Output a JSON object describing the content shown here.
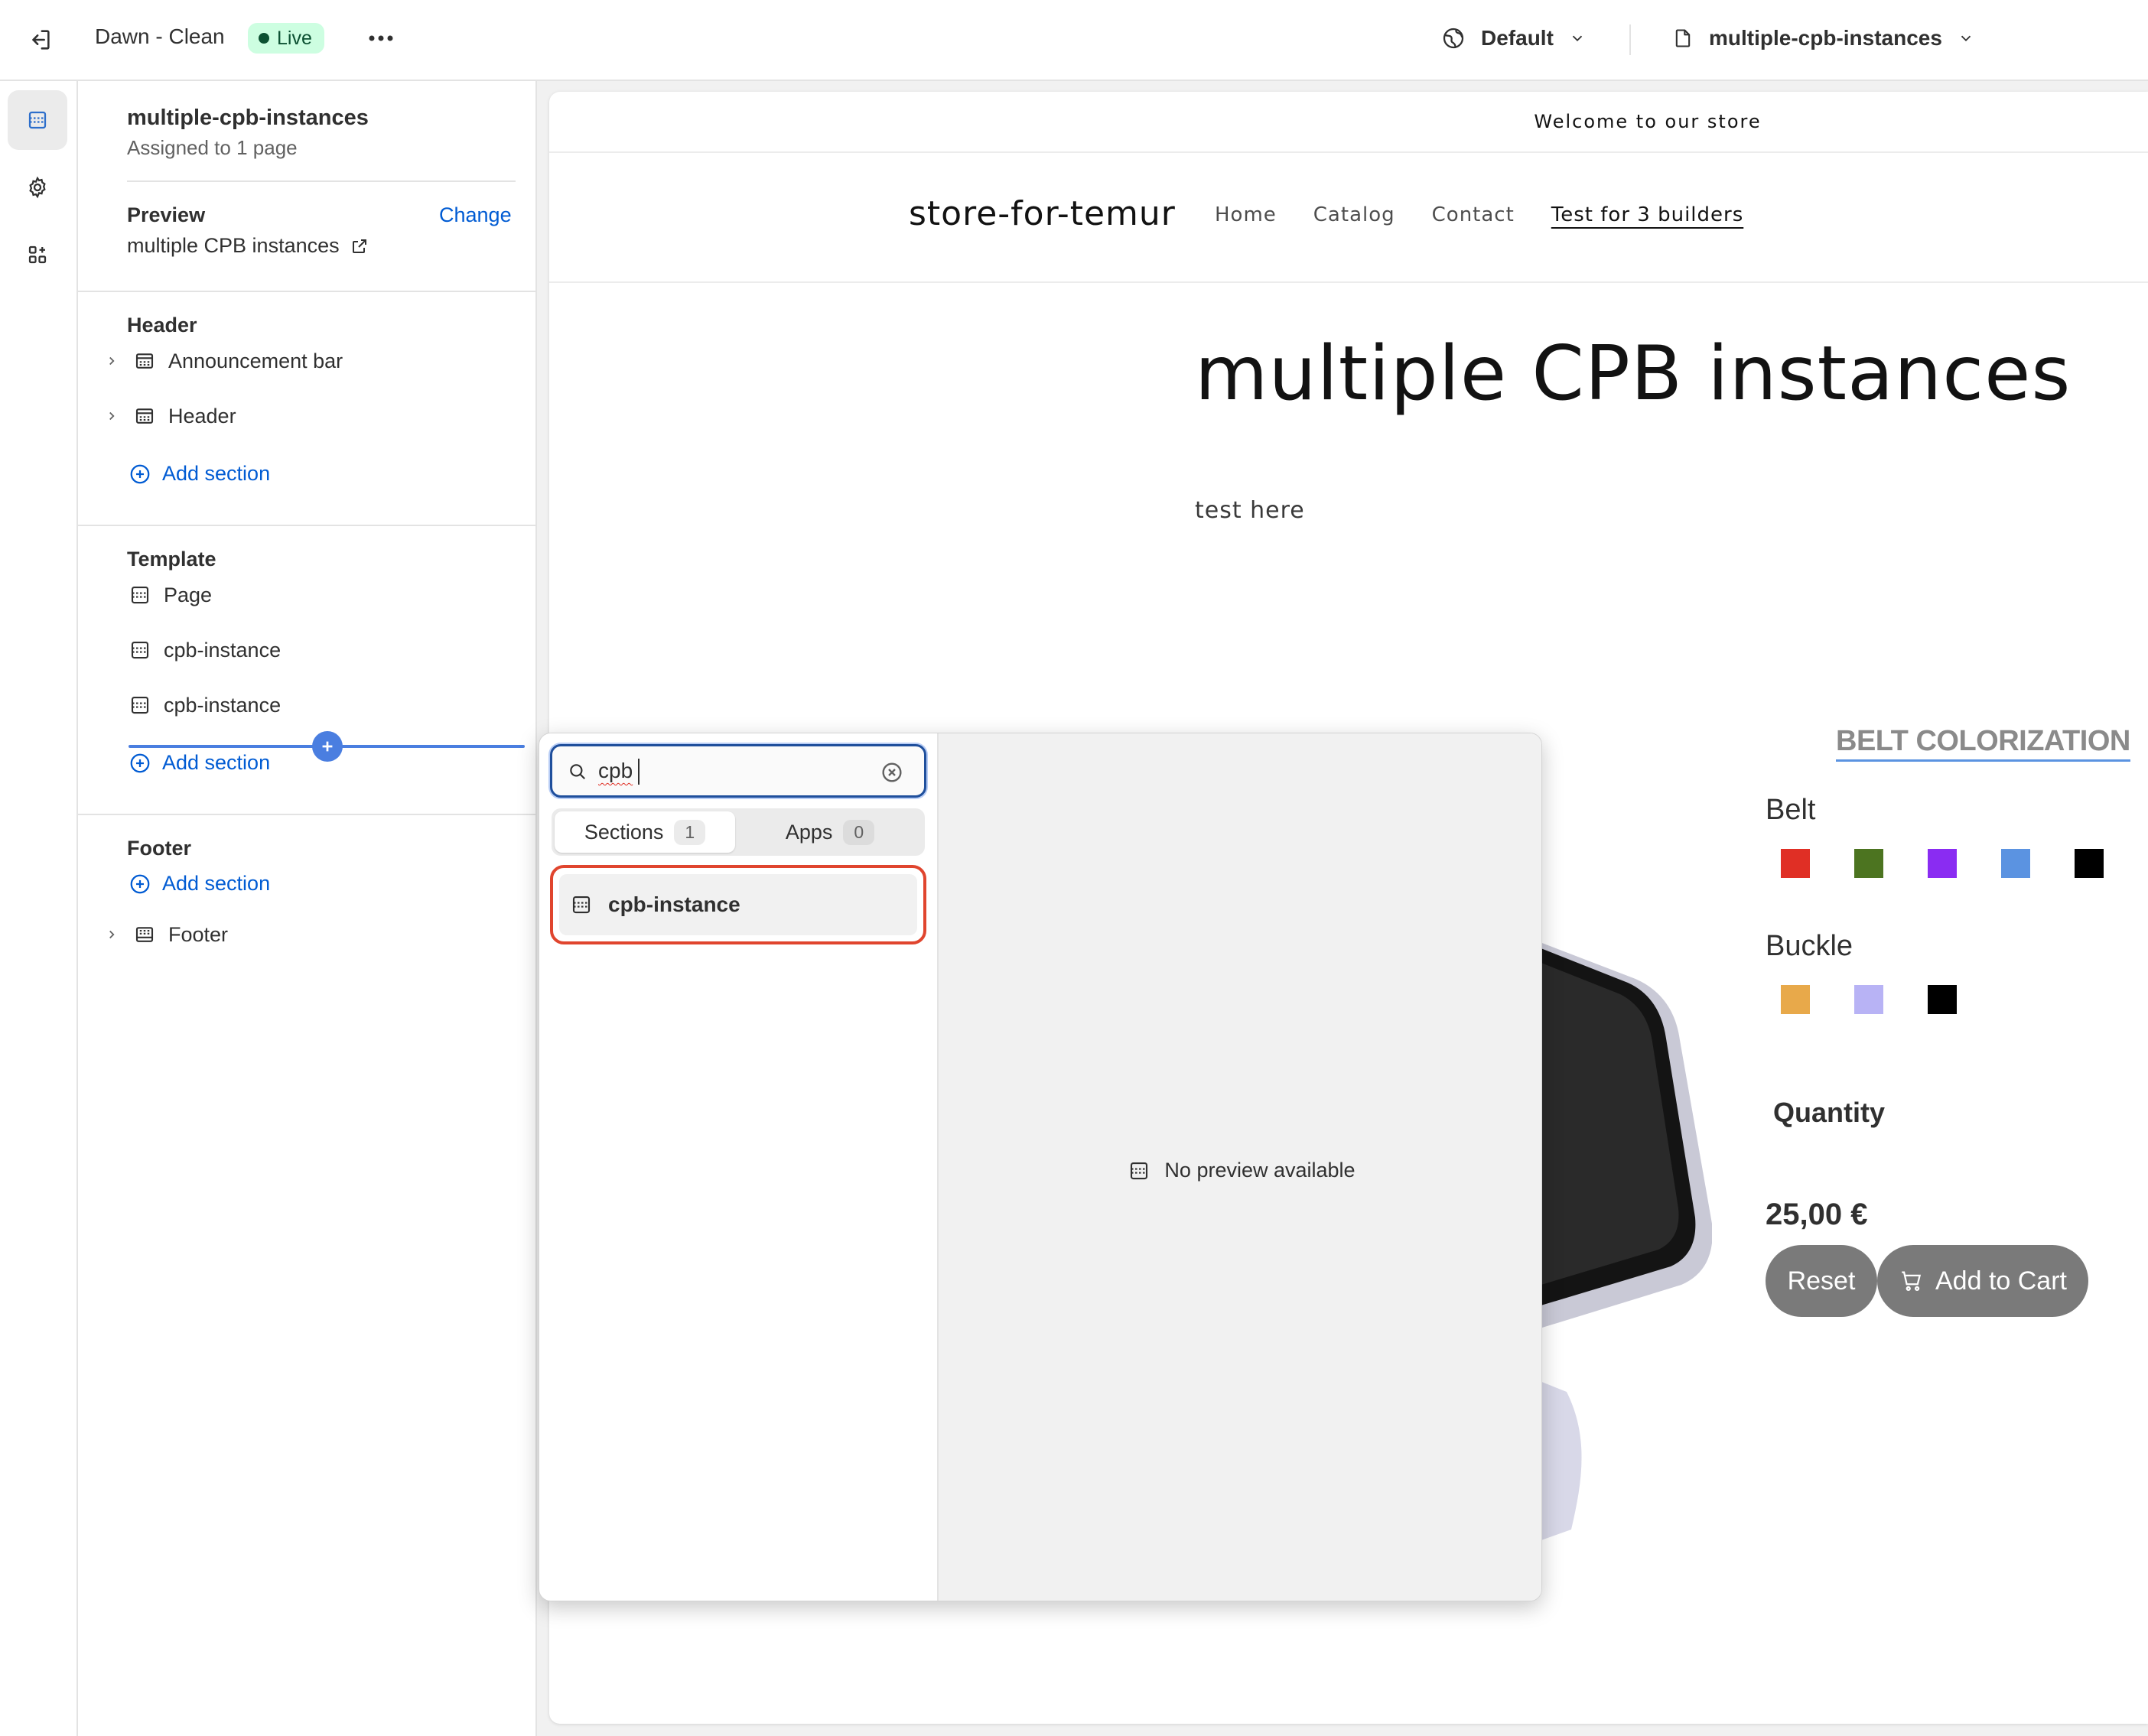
{
  "topbar": {
    "theme_name": "Dawn - Clean",
    "live_label": "Live",
    "locale_label": "Default",
    "template_label": "multiple-cpb-instances"
  },
  "sidebar": {
    "template_title": "multiple-cpb-instances",
    "assigned_label": "Assigned to 1 page",
    "preview_heading": "Preview",
    "change_label": "Change",
    "preview_page": "multiple CPB instances",
    "header_group": {
      "heading": "Header",
      "items": [
        {
          "label": "Announcement bar"
        },
        {
          "label": "Header"
        }
      ],
      "add_label": "Add section"
    },
    "template_group": {
      "heading": "Template",
      "items": [
        {
          "label": "Page"
        },
        {
          "label": "cpb-instance"
        },
        {
          "label": "cpb-instance"
        }
      ],
      "add_label": "Add section"
    },
    "footer_group": {
      "heading": "Footer",
      "add_label": "Add section",
      "items": [
        {
          "label": "Footer"
        }
      ]
    }
  },
  "store": {
    "announcement": "Welcome to our store",
    "name": "store-for-temur",
    "nav": [
      "Home",
      "Catalog",
      "Contact",
      "Test for 3 builders"
    ],
    "page_title": "multiple CPB instances",
    "page_body": "test here",
    "builder": {
      "heading": "BELT COLORIZATION",
      "belt_label": "Belt",
      "belt_colors": [
        "#e02f25",
        "#4c7420",
        "#8a2cf2",
        "#5b93e1",
        "#000000"
      ],
      "buckle_label": "Buckle",
      "buckle_colors": [
        "#e8a94a",
        "#b8b3f5",
        "#000000"
      ],
      "quantity_label": "Quantity",
      "price": "25,00 €",
      "reset_label": "Reset",
      "add_to_cart_label": "Add to Cart"
    }
  },
  "popover": {
    "search_value": "cpb",
    "tabs": [
      {
        "label": "Sections",
        "count": "1"
      },
      {
        "label": "Apps",
        "count": "0"
      }
    ],
    "results": [
      {
        "label": "cpb-instance"
      }
    ],
    "no_preview": "No preview available"
  }
}
